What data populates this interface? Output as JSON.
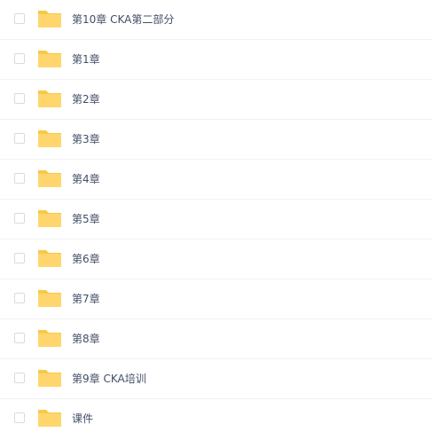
{
  "colors": {
    "folder_front": "#FFD66E",
    "folder_back": "#F7C948",
    "text": "#424E67",
    "checkbox_border": "#D7DBE1",
    "divider": "#F1F2F4"
  },
  "rows": [
    {
      "name": "第10章 CKA第二部分",
      "icon": "folder-icon"
    },
    {
      "name": "第1章",
      "icon": "folder-icon"
    },
    {
      "name": "第2章",
      "icon": "folder-icon"
    },
    {
      "name": "第3章",
      "icon": "folder-icon"
    },
    {
      "name": "第4章",
      "icon": "folder-icon"
    },
    {
      "name": "第5章",
      "icon": "folder-icon"
    },
    {
      "name": "第6章",
      "icon": "folder-icon"
    },
    {
      "name": "第7章",
      "icon": "folder-icon"
    },
    {
      "name": "第8章",
      "icon": "folder-icon"
    },
    {
      "name": "第9章 CKA培训",
      "icon": "folder-icon"
    },
    {
      "name": "课件",
      "icon": "folder-icon"
    }
  ]
}
